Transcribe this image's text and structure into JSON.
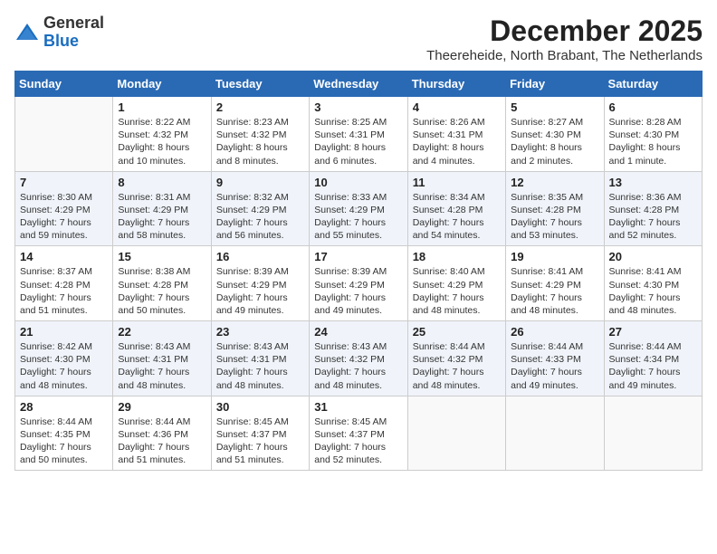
{
  "header": {
    "logo_general": "General",
    "logo_blue": "Blue",
    "month_year": "December 2025",
    "location": "Theereheide, North Brabant, The Netherlands"
  },
  "weekdays": [
    "Sunday",
    "Monday",
    "Tuesday",
    "Wednesday",
    "Thursday",
    "Friday",
    "Saturday"
  ],
  "weeks": [
    [
      {
        "day": "",
        "info": ""
      },
      {
        "day": "1",
        "info": "Sunrise: 8:22 AM\nSunset: 4:32 PM\nDaylight: 8 hours\nand 10 minutes."
      },
      {
        "day": "2",
        "info": "Sunrise: 8:23 AM\nSunset: 4:32 PM\nDaylight: 8 hours\nand 8 minutes."
      },
      {
        "day": "3",
        "info": "Sunrise: 8:25 AM\nSunset: 4:31 PM\nDaylight: 8 hours\nand 6 minutes."
      },
      {
        "day": "4",
        "info": "Sunrise: 8:26 AM\nSunset: 4:31 PM\nDaylight: 8 hours\nand 4 minutes."
      },
      {
        "day": "5",
        "info": "Sunrise: 8:27 AM\nSunset: 4:30 PM\nDaylight: 8 hours\nand 2 minutes."
      },
      {
        "day": "6",
        "info": "Sunrise: 8:28 AM\nSunset: 4:30 PM\nDaylight: 8 hours\nand 1 minute."
      }
    ],
    [
      {
        "day": "7",
        "info": "Sunrise: 8:30 AM\nSunset: 4:29 PM\nDaylight: 7 hours\nand 59 minutes."
      },
      {
        "day": "8",
        "info": "Sunrise: 8:31 AM\nSunset: 4:29 PM\nDaylight: 7 hours\nand 58 minutes."
      },
      {
        "day": "9",
        "info": "Sunrise: 8:32 AM\nSunset: 4:29 PM\nDaylight: 7 hours\nand 56 minutes."
      },
      {
        "day": "10",
        "info": "Sunrise: 8:33 AM\nSunset: 4:29 PM\nDaylight: 7 hours\nand 55 minutes."
      },
      {
        "day": "11",
        "info": "Sunrise: 8:34 AM\nSunset: 4:28 PM\nDaylight: 7 hours\nand 54 minutes."
      },
      {
        "day": "12",
        "info": "Sunrise: 8:35 AM\nSunset: 4:28 PM\nDaylight: 7 hours\nand 53 minutes."
      },
      {
        "day": "13",
        "info": "Sunrise: 8:36 AM\nSunset: 4:28 PM\nDaylight: 7 hours\nand 52 minutes."
      }
    ],
    [
      {
        "day": "14",
        "info": "Sunrise: 8:37 AM\nSunset: 4:28 PM\nDaylight: 7 hours\nand 51 minutes."
      },
      {
        "day": "15",
        "info": "Sunrise: 8:38 AM\nSunset: 4:28 PM\nDaylight: 7 hours\nand 50 minutes."
      },
      {
        "day": "16",
        "info": "Sunrise: 8:39 AM\nSunset: 4:29 PM\nDaylight: 7 hours\nand 49 minutes."
      },
      {
        "day": "17",
        "info": "Sunrise: 8:39 AM\nSunset: 4:29 PM\nDaylight: 7 hours\nand 49 minutes."
      },
      {
        "day": "18",
        "info": "Sunrise: 8:40 AM\nSunset: 4:29 PM\nDaylight: 7 hours\nand 48 minutes."
      },
      {
        "day": "19",
        "info": "Sunrise: 8:41 AM\nSunset: 4:29 PM\nDaylight: 7 hours\nand 48 minutes."
      },
      {
        "day": "20",
        "info": "Sunrise: 8:41 AM\nSunset: 4:30 PM\nDaylight: 7 hours\nand 48 minutes."
      }
    ],
    [
      {
        "day": "21",
        "info": "Sunrise: 8:42 AM\nSunset: 4:30 PM\nDaylight: 7 hours\nand 48 minutes."
      },
      {
        "day": "22",
        "info": "Sunrise: 8:43 AM\nSunset: 4:31 PM\nDaylight: 7 hours\nand 48 minutes."
      },
      {
        "day": "23",
        "info": "Sunrise: 8:43 AM\nSunset: 4:31 PM\nDaylight: 7 hours\nand 48 minutes."
      },
      {
        "day": "24",
        "info": "Sunrise: 8:43 AM\nSunset: 4:32 PM\nDaylight: 7 hours\nand 48 minutes."
      },
      {
        "day": "25",
        "info": "Sunrise: 8:44 AM\nSunset: 4:32 PM\nDaylight: 7 hours\nand 48 minutes."
      },
      {
        "day": "26",
        "info": "Sunrise: 8:44 AM\nSunset: 4:33 PM\nDaylight: 7 hours\nand 49 minutes."
      },
      {
        "day": "27",
        "info": "Sunrise: 8:44 AM\nSunset: 4:34 PM\nDaylight: 7 hours\nand 49 minutes."
      }
    ],
    [
      {
        "day": "28",
        "info": "Sunrise: 8:44 AM\nSunset: 4:35 PM\nDaylight: 7 hours\nand 50 minutes."
      },
      {
        "day": "29",
        "info": "Sunrise: 8:44 AM\nSunset: 4:36 PM\nDaylight: 7 hours\nand 51 minutes."
      },
      {
        "day": "30",
        "info": "Sunrise: 8:45 AM\nSunset: 4:37 PM\nDaylight: 7 hours\nand 51 minutes."
      },
      {
        "day": "31",
        "info": "Sunrise: 8:45 AM\nSunset: 4:37 PM\nDaylight: 7 hours\nand 52 minutes."
      },
      {
        "day": "",
        "info": ""
      },
      {
        "day": "",
        "info": ""
      },
      {
        "day": "",
        "info": ""
      }
    ]
  ]
}
